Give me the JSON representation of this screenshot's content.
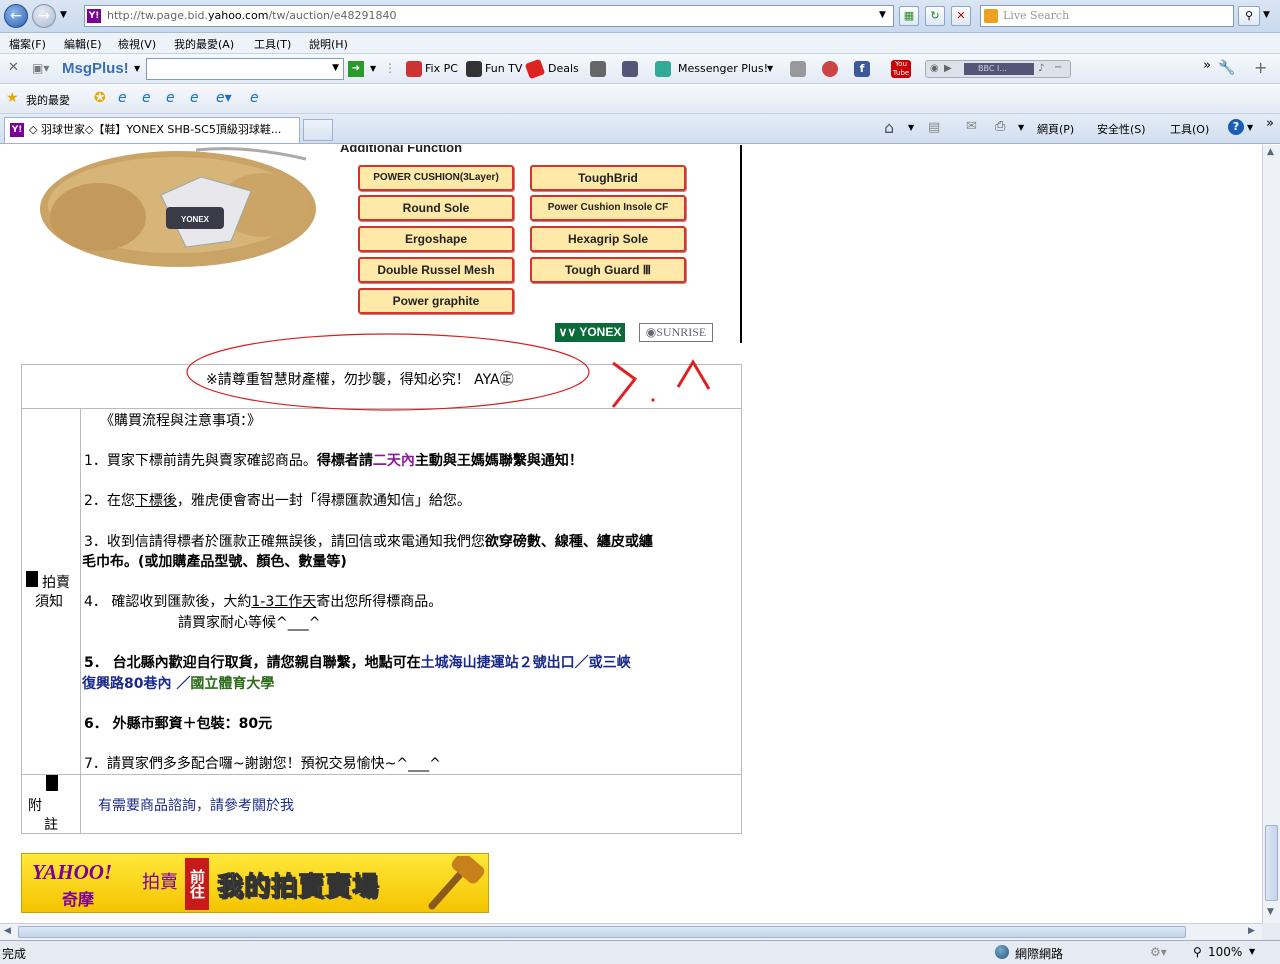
{
  "browser": {
    "url_prefix": "http://tw.page.bid.",
    "url_domain": "yahoo.com",
    "url_path": "/tw/auction/e48291840",
    "search_placeholder": "Live Search",
    "menu": [
      "檔案(F)",
      "編輯(E)",
      "檢視(V)",
      "我的最愛(A)",
      "工具(T)",
      "說明(H)"
    ],
    "msgplus_label": "MsgPlus!",
    "toolbar_items": [
      "Fix PC",
      "Fun TV",
      "Deals",
      "Messenger Plus!"
    ],
    "bbc_label": "BBC I...",
    "favorites_label": "我的最愛",
    "tab_title": "◇ 羽球世家◇【鞋】YONEX SHB-SC5頂級羽球鞋...",
    "cmd_items": [
      "網頁(P)",
      "安全性(S)",
      "工具(O)"
    ],
    "status_text": "完成",
    "zone_text": "網際網路",
    "zoom_text": "100%"
  },
  "product": {
    "function_title": "Additional Function",
    "features_left": [
      "POWER CUSHION(3Layer)",
      "Round Sole",
      "Ergoshape",
      "Double Russel Mesh",
      "Power graphite"
    ],
    "features_right": [
      "ToughBrid",
      "Power Cushion Insole CF",
      "Hexagrip Sole",
      "Tough Guard Ⅲ"
    ],
    "brand_yonex": "YONEX",
    "brand_sunrise": "SUNRISE",
    "shoe_logo": "YONEX"
  },
  "notice": {
    "copyright": "※請尊重智慧財產權，勿抄襲，得知必究！ AYA㊣",
    "annotation": "> . ^",
    "label_auction": "拍賣",
    "label_notice": "須知",
    "heading": "《購買流程與注意事項：》",
    "l1_a": "1．買家下標前請先與賣家確認商品。",
    "l1_b": "得標者請",
    "l1_c": "二天內",
    "l1_d": "主動與王媽媽聯繫與通知！",
    "l2_a": "2．在您",
    "l2_b": "下標後",
    "l2_c": "，雅虎便會寄出一封「得標匯款通知信」給您。",
    "l3_a": "3．收到信請得標者於匯款正確無誤後，請回信或來電通知我們您",
    "l3_b": "欲穿磅數、線種、纏皮或纏",
    "l3_c": "毛巾布。(或加購產品型號、顏色、數量等)",
    "l4_a": "4． 確認收到匯款後，大約",
    "l4_b": "1-3工作天",
    "l4_c": "寄出您所得標商品。",
    "l4_d": "請買家耐心等候^___^",
    "l5_a": "5． 台北縣內歡迎自行取貨，請您親自聯繫，地點可在",
    "l5_b": "土城海山捷運站２號出口／或三峽",
    "l5_c": "復興路80巷內 ／",
    "l5_d": "國立體育大學",
    "l6": "6． 外縣市郵資＋包裝：80元",
    "l7": "7．請買家們多多配合囉~謝謝您！預祝交易愉快~^___^",
    "label_fu": "附",
    "label_zhu": "註",
    "footer_link": "有需要商品諮詢，請參考關於我"
  },
  "banner": {
    "yahoo": "YAHOO!",
    "qimo": "奇摩",
    "auction": "拍賣",
    "goto": "前往",
    "store": "我的拍賣賣場"
  }
}
